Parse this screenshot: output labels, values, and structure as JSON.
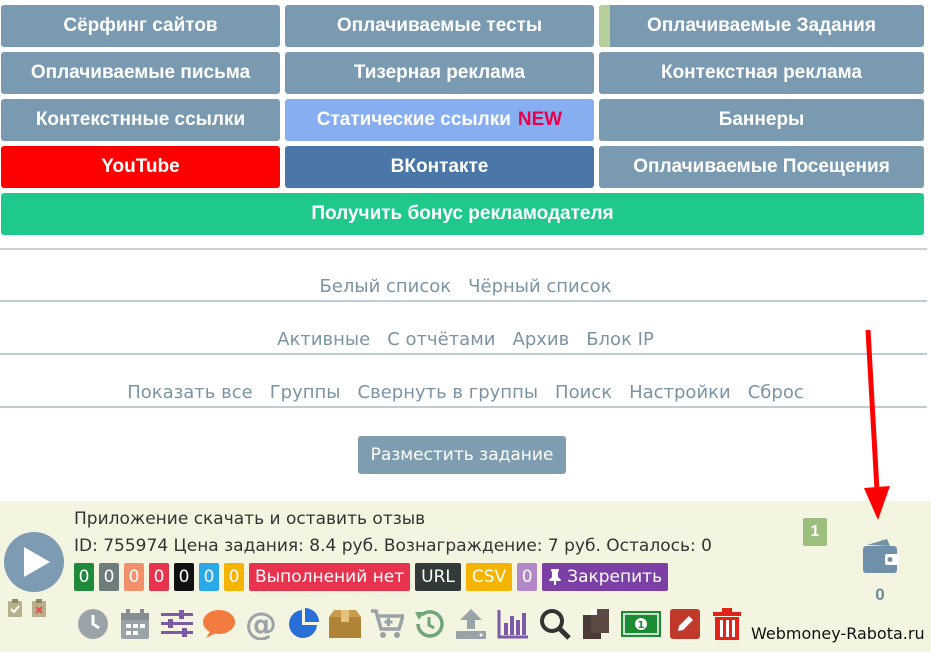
{
  "nav": {
    "row1": [
      "Сёрфинг сайтов",
      "Оплачиваемые тесты",
      "Оплачиваемые Задания"
    ],
    "row2": [
      "Оплачиваемые письма",
      "Тизерная реклама",
      "Контекстная реклама"
    ],
    "row3": [
      "Контекстнные ссылки",
      "Статические ссылки",
      "Баннеры"
    ],
    "row3_new": "NEW",
    "row4": [
      "YouTube",
      "ВКонтакте",
      "Оплачиваемые Посещения"
    ],
    "bonus": "Получить бонус рекламодателя"
  },
  "lists": [
    "Белый список",
    "Чёрный список"
  ],
  "filters": [
    "Активные",
    "С отчётами",
    "Архив",
    "Блок IP"
  ],
  "actions": [
    "Показать все",
    "Группы",
    "Свернуть в группы",
    "Поиск",
    "Настройки",
    "Сброс"
  ],
  "place_task": "Разместить задание",
  "task": {
    "title": "Приложение скачать и оставить отзыв",
    "info": "ID: 755974 Цена задания: 8.4 руб. Вознаграждение: 7 руб. Осталось: 0",
    "counters": [
      {
        "value": "0",
        "color": "#1f8a3a"
      },
      {
        "value": "0",
        "color": "#6d7d7b"
      },
      {
        "value": "0",
        "color": "#f2906c"
      },
      {
        "value": "0",
        "color": "#e8334f"
      },
      {
        "value": "0",
        "color": "#111111"
      },
      {
        "value": "0",
        "color": "#2aa9e8"
      },
      {
        "value": "0",
        "color": "#f4b400"
      }
    ],
    "no_completions": "Выполнений нет",
    "url": "URL",
    "csv": "CSV",
    "zero": "0",
    "pin": "Закрепить",
    "count": "1",
    "wallet_count": "0"
  },
  "toolbar_icons": [
    "clock-icon",
    "calendar-icon",
    "sliders-icon",
    "comment-icon",
    "at-icon",
    "pie-chart-icon",
    "box-icon",
    "cart-icon",
    "history-icon",
    "upload-icon",
    "bar-chart-icon",
    "search-icon",
    "copy-icon",
    "money-icon",
    "edit-icon",
    "trash-icon"
  ],
  "watermark": "Webmoney-Rabota.ru"
}
